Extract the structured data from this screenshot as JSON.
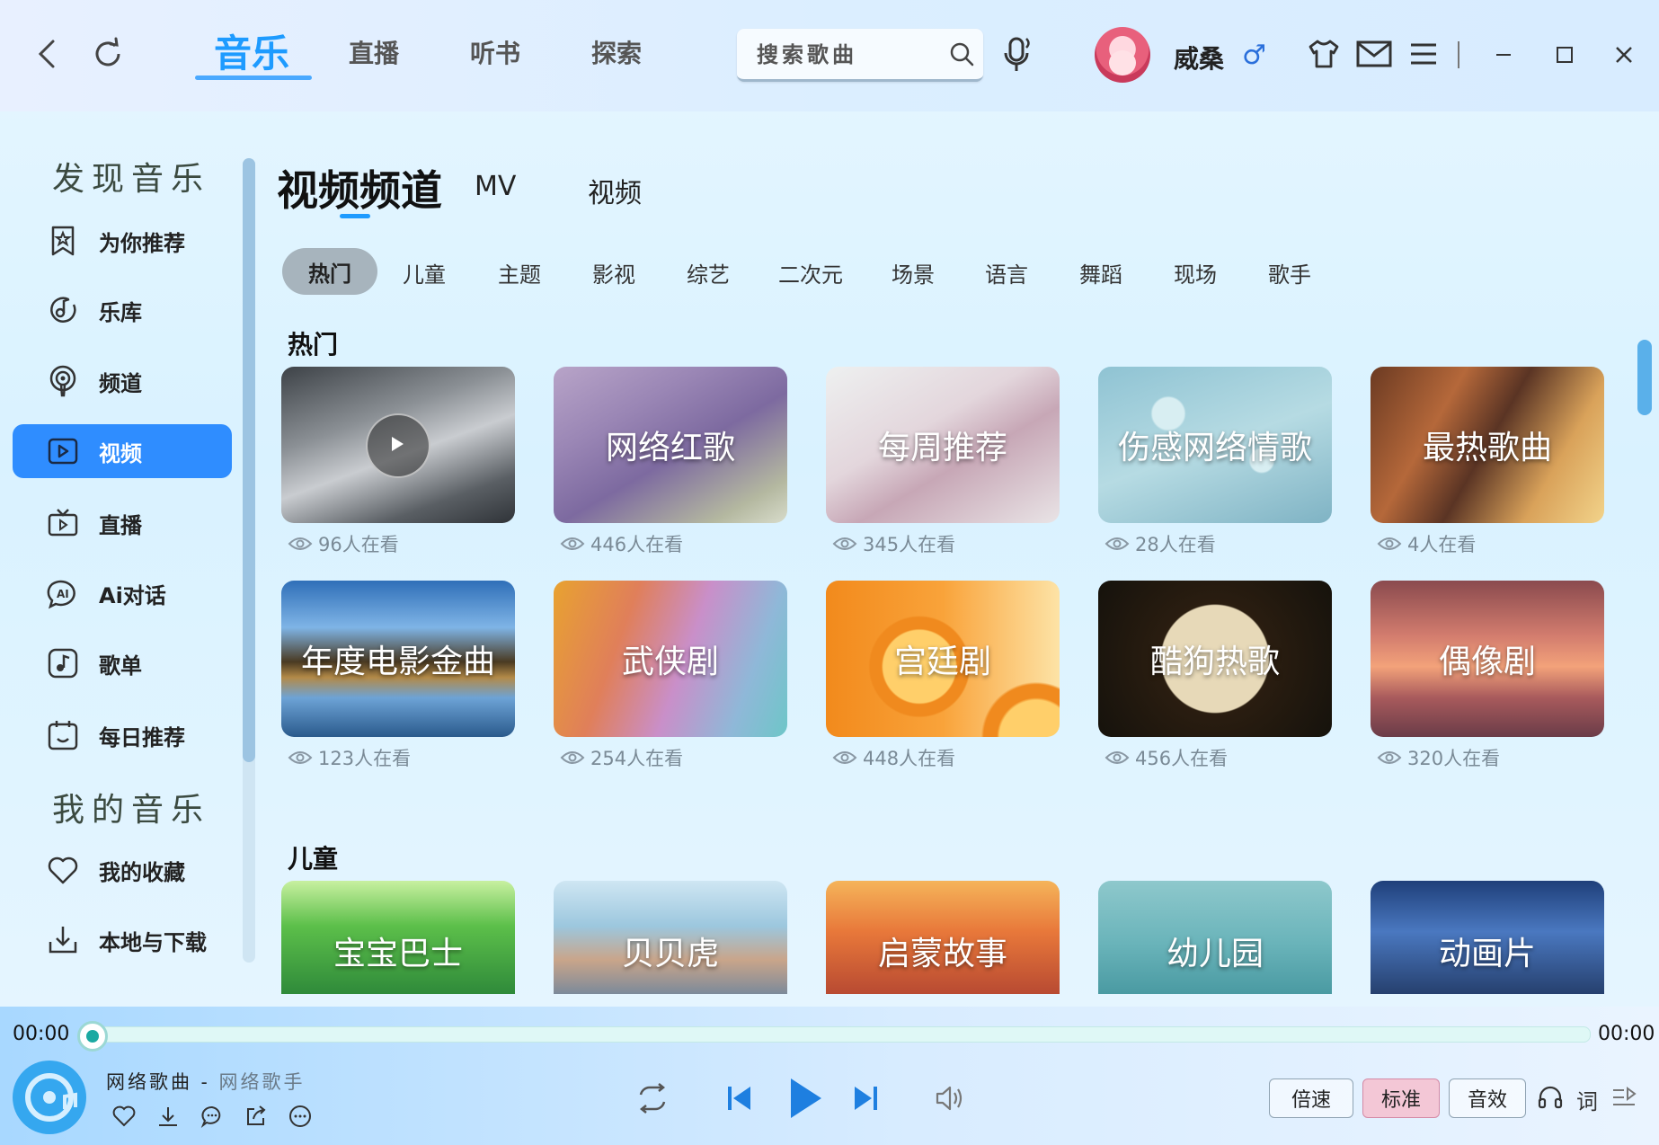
{
  "header": {
    "tabs": [
      "音乐",
      "直播",
      "听书",
      "探索"
    ],
    "search_placeholder": "搜索歌曲",
    "username": "威桑",
    "gender_symbol": "♂"
  },
  "sidebar": {
    "discover_title": "发现音乐",
    "discover_items": [
      {
        "label": "为你推荐",
        "icon": "star-bookmark-icon"
      },
      {
        "label": "乐库",
        "icon": "music-disc-icon"
      },
      {
        "label": "频道",
        "icon": "podcast-icon"
      },
      {
        "label": "视频",
        "icon": "video-play-icon",
        "active": true
      },
      {
        "label": "直播",
        "icon": "tv-icon"
      },
      {
        "label": "Ai对话",
        "icon": "ai-chat-icon"
      },
      {
        "label": "歌单",
        "icon": "playlist-note-icon"
      },
      {
        "label": "每日推荐",
        "icon": "calendar-icon"
      }
    ],
    "my_music_title": "我的音乐",
    "my_items": [
      {
        "label": "我的收藏",
        "icon": "heart-icon"
      },
      {
        "label": "本地与下载",
        "icon": "download-icon"
      }
    ]
  },
  "main": {
    "title": "视频频道",
    "sub_tabs": [
      "MV",
      "视频"
    ],
    "categories": [
      "热门",
      "儿童",
      "主题",
      "影视",
      "综艺",
      "二次元",
      "场景",
      "语言",
      "舞蹈",
      "现场",
      "歌手"
    ],
    "sections": [
      {
        "title": "热门",
        "cards": [
          {
            "title": "",
            "viewers": "96人在看"
          },
          {
            "title": "网络红歌",
            "viewers": "446人在看"
          },
          {
            "title": "每周推荐",
            "viewers": "345人在看"
          },
          {
            "title": "伤感网络情歌",
            "viewers": "28人在看"
          },
          {
            "title": "最热歌曲",
            "viewers": "4人在看"
          },
          {
            "title": "年度电影金曲",
            "viewers": "123人在看"
          },
          {
            "title": "武侠剧",
            "viewers": "254人在看"
          },
          {
            "title": "宫廷剧",
            "viewers": "448人在看"
          },
          {
            "title": "酷狗热歌",
            "viewers": "456人在看"
          },
          {
            "title": "偶像剧",
            "viewers": "320人在看"
          }
        ]
      },
      {
        "title": "儿童",
        "cards": [
          {
            "title": "宝宝巴士"
          },
          {
            "title": "贝贝虎"
          },
          {
            "title": "启蒙故事"
          },
          {
            "title": "幼儿园"
          },
          {
            "title": "动画片"
          }
        ]
      }
    ]
  },
  "player": {
    "time_current": "00:00",
    "time_total": "00:00",
    "progress": 0,
    "song": "网络歌曲",
    "separator": " - ",
    "artist": "网络歌手",
    "speed_label": "倍速",
    "quality_label": "标准",
    "effect_label": "音效",
    "lyric_label": "词"
  },
  "colors": {
    "accent": "#1e9bff",
    "sidebar_active": "#2f8dff",
    "quality_active": "#f3c7d6"
  }
}
